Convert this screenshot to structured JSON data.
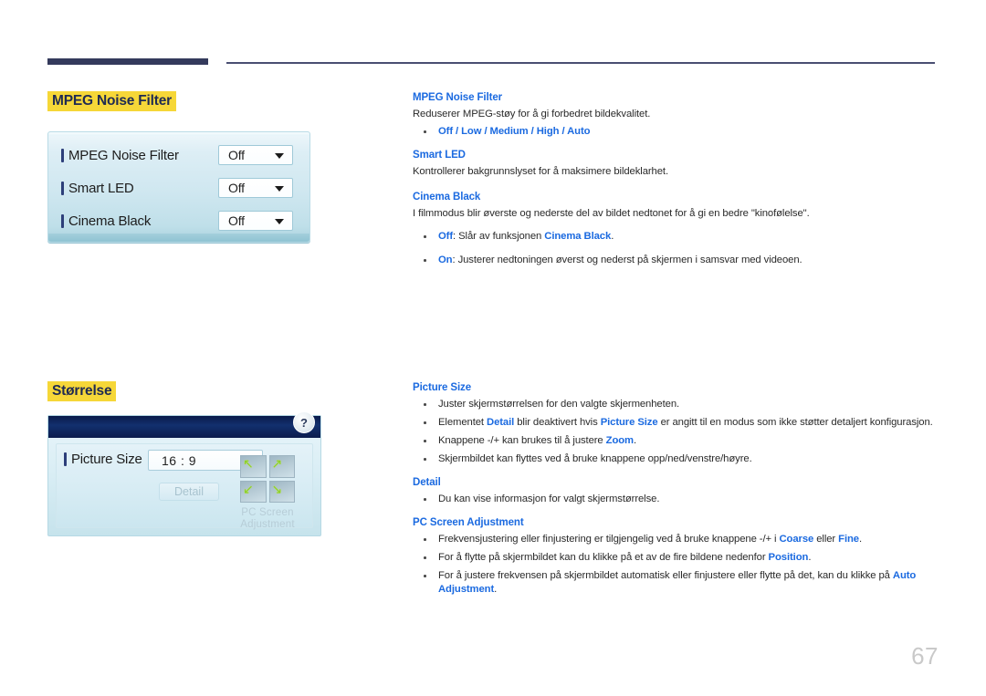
{
  "page": {
    "number": "67"
  },
  "headings": {
    "mpeg_noise_filter": "MPEG Noise Filter",
    "storrelse": "Størrelse"
  },
  "osd_mpeg": {
    "rows": [
      {
        "label": "MPEG Noise Filter",
        "value": "Off"
      },
      {
        "label": "Smart LED",
        "value": "Off"
      },
      {
        "label": "Cinema Black",
        "value": "Off"
      }
    ]
  },
  "osd_picture_size": {
    "help_icon": "?",
    "picture_size_label": "Picture Size",
    "picture_size_value": "16 : 9",
    "detail_button": "Detail",
    "pc_screen_adjustment_label": "PC Screen Adjustment",
    "arrow_glyphs": [
      "↖",
      "↗",
      "↙",
      "↘"
    ]
  },
  "descriptions": {
    "mpeg_noise_filter": {
      "title": "MPEG Noise Filter",
      "body": "Reduserer MPEG-støy for å gi forbedret bildekvalitet.",
      "options_prefix": "Off",
      "options_rest": " / Low / Medium / High / Auto",
      "options_full": "Off / Low / Medium / High / Auto"
    },
    "smart_led": {
      "title": "Smart LED",
      "body": "Kontrollerer bakgrunnslyset for å maksimere bildeklarhet."
    },
    "cinema_black": {
      "title": "Cinema Black",
      "body": "I filmmodus blir øverste og nederste del av bildet nedtonet for å gi en bedre \"kinofølelse\".",
      "bullet_off_key": "Off",
      "bullet_off_text": ": Slår av funksjonen ",
      "bullet_off_ref": "Cinema Black",
      "bullet_off_end": ".",
      "bullet_on_key": "On",
      "bullet_on_text": ": Justerer nedtoningen øverst og nederst på skjermen i samsvar med videoen."
    },
    "picture_size": {
      "title": "Picture Size",
      "bullet1": "Juster skjermstørrelsen for den valgte skjermenheten.",
      "bullet2_a": "Elementet ",
      "bullet2_k1": "Detail",
      "bullet2_b": " blir deaktivert hvis ",
      "bullet2_k2": "Picture Size",
      "bullet2_c": " er angitt til en modus som ikke støtter detaljert konfigurasjon.",
      "bullet3_a": "Knappene -/+ kan brukes til å justere ",
      "bullet3_k": "Zoom",
      "bullet3_b": ".",
      "bullet4": "Skjermbildet kan flyttes ved å bruke knappene opp/ned/venstre/høyre."
    },
    "detail": {
      "title": "Detail",
      "bullet1": "Du kan vise informasjon for valgt skjermstørrelse."
    },
    "pc_screen_adjustment": {
      "title": "PC Screen Adjustment",
      "bullet1_a": "Frekvensjustering eller finjustering er tilgjengelig ved å bruke knappene -/+ i ",
      "bullet1_k1": "Coarse",
      "bullet1_b": " eller ",
      "bullet1_k2": "Fine",
      "bullet1_c": ".",
      "bullet2_a": "For å flytte på skjermbildet kan du klikke på et av de fire bildene nedenfor ",
      "bullet2_k": "Position",
      "bullet2_b": ".",
      "bullet3_a": "For å justere frekvensen på skjermbildet automatisk eller finjustere eller flytte på det, kan du klikke på ",
      "bullet3_k": "Auto Adjustment",
      "bullet3_b": "."
    }
  },
  "colors": {
    "highlight": "#f6d738",
    "heading_text": "#1f2a52",
    "link_blue": "#1b6ae0",
    "rule_navy": "#343a5c",
    "osd_header_navy": "#0a1a4a",
    "page_number_gray": "#c9c9c9"
  }
}
